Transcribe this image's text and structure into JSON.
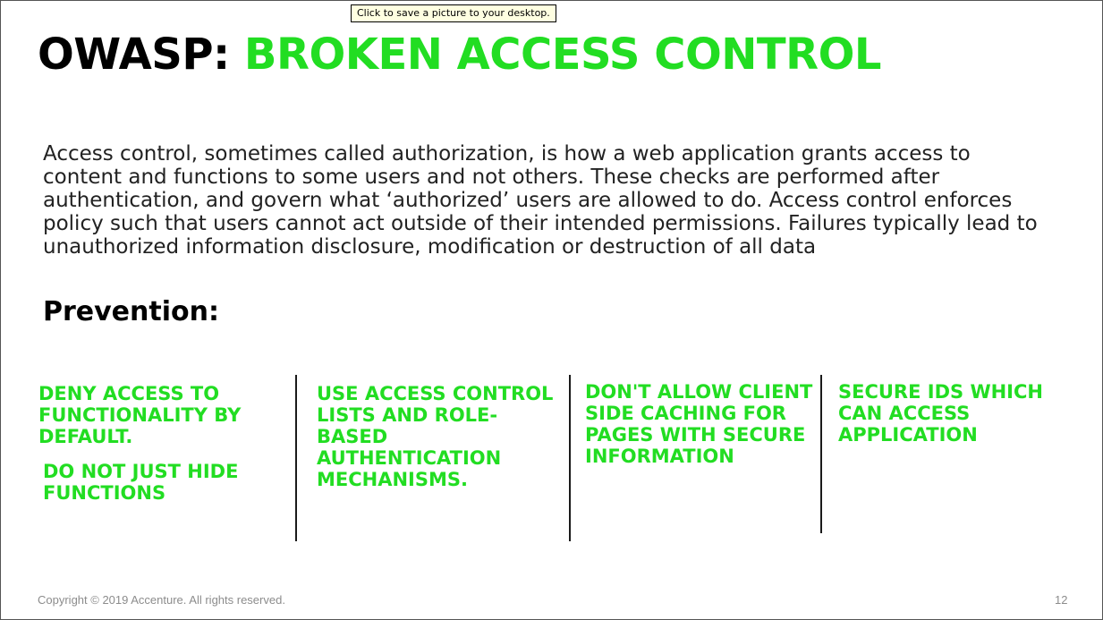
{
  "tooltip": "Click to save a picture to your desktop.",
  "title": {
    "prefix": "OWASP:",
    "accent": "BROKEN ACCESS CONTROL"
  },
  "body": "Access control, sometimes called authorization, is how a web application grants access to content and functions to some users and not others. These checks are performed after authentication, and govern what ‘authorized’ users are allowed to do. Access control enforces policy such that users cannot act outside of their intended permissions. Failures typically lead to unauthorized information disclosure, modification or destruction of all data",
  "prevention_heading": "Prevention:",
  "columns": [
    {
      "items": [
        "DENY ACCESS TO FUNCTIONALITY BY DEFAULT.",
        "DO NOT JUST HIDE FUNCTIONS"
      ]
    },
    {
      "items": [
        "USE ACCESS CONTROL LISTS AND ROLE-BASED AUTHENTICATION MECHANISMS."
      ]
    },
    {
      "items": [
        "DON'T ALLOW CLIENT SIDE CACHING FOR PAGES WITH SECURE INFORMATION"
      ]
    },
    {
      "items": [
        "SECURE IDS WHICH CAN ACCESS APPLICATION"
      ]
    }
  ],
  "footer": {
    "copyright": "Copyright © 2019 Accenture. All rights reserved.",
    "page_number": "12"
  },
  "colors": {
    "accent_green": "#22dd22",
    "text_black": "#000000",
    "footer_gray": "#8c8c8c"
  }
}
